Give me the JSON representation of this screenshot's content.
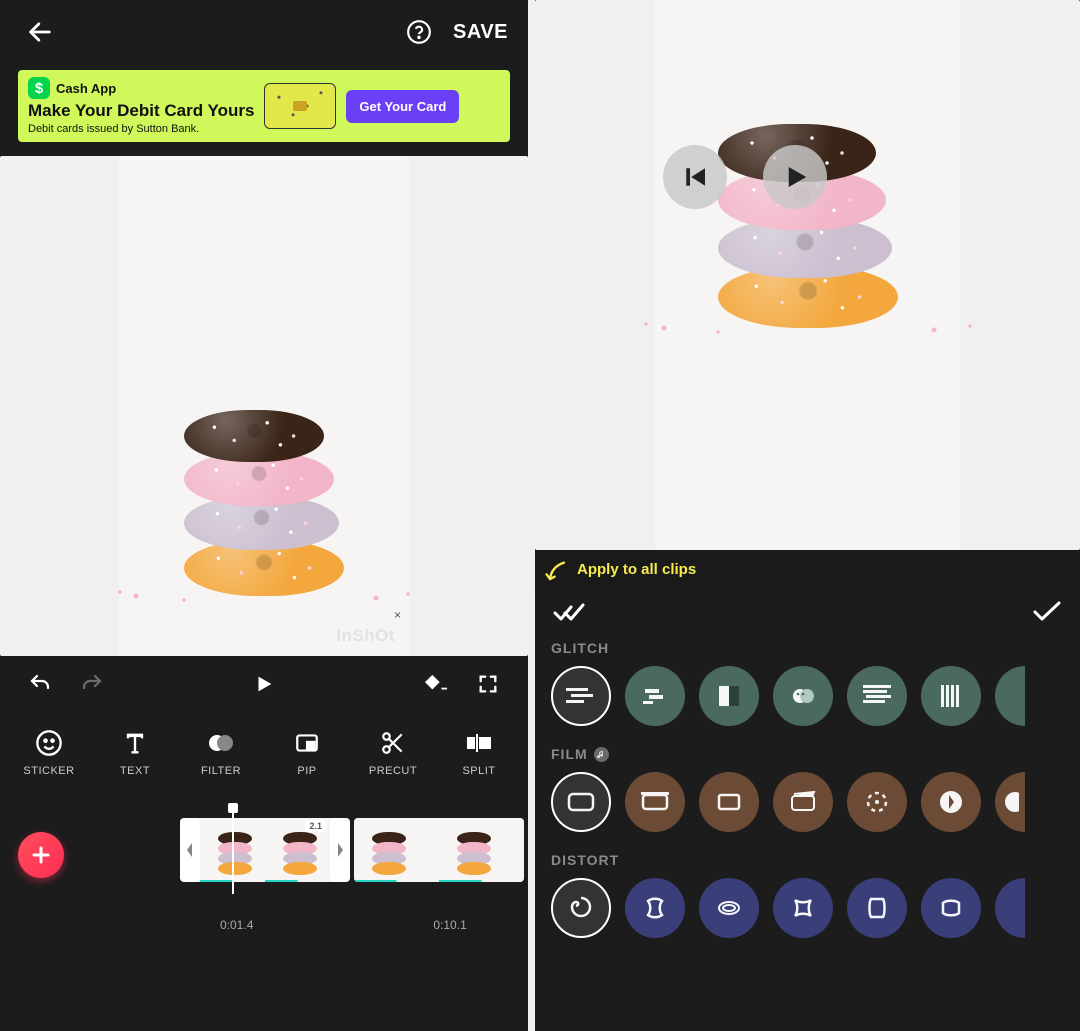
{
  "left": {
    "save": "SAVE",
    "ad": {
      "icon_letter": "$",
      "title": "Cash App",
      "headline": "Make Your Debit Card Yours",
      "sub": "Debit cards issued by Sutton Bank.",
      "cta": "Get Your Card"
    },
    "watermark": "InShOt",
    "tools": [
      "STICKER",
      "TEXT",
      "FILTER",
      "PIP",
      "PRECUT",
      "SPLIT"
    ],
    "speed_badge": "2.1",
    "time_a": "0:01.4",
    "time_b": "0:10.1"
  },
  "right": {
    "apply_label": "Apply to all clips",
    "categories": {
      "glitch": "GLITCH",
      "film": "FILM",
      "distort": "DISTORT"
    }
  }
}
